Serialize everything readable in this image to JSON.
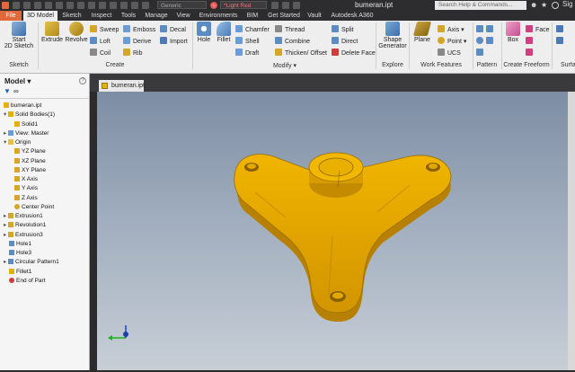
{
  "app": {
    "window_title": "bumeran.ipt",
    "material": "Generic",
    "appearance": "Light Red",
    "search_placeholder": "Search Help & Commands..."
  },
  "tabs": [
    "File",
    "3D Model",
    "Sketch",
    "Inspect",
    "Tools",
    "Manage",
    "View",
    "Environments",
    "BIM",
    "Get Started",
    "Vault",
    "Autodesk A360"
  ],
  "active_tab": "3D Model",
  "ribbon": {
    "sketch": {
      "panel": "Sketch",
      "start_line1": "Start",
      "start_line2": "2D Sketch"
    },
    "create": {
      "panel": "Create",
      "extrude": "Extrude",
      "revolve": "Revolve",
      "sweep": "Sweep",
      "loft": "Loft",
      "coil": "Coil",
      "emboss": "Emboss",
      "derive": "Derive",
      "rib": "Rib",
      "decal": "Decal",
      "import": "Import"
    },
    "modify": {
      "panel": "Modify",
      "hole": "Hole",
      "fillet": "Fillet",
      "chamfer": "Chamfer",
      "shell": "Shell",
      "draft": "Draft",
      "thread": "Thread",
      "combine": "Combine",
      "thicken": "Thicken/ Offset",
      "split": "Split",
      "direct": "Direct",
      "delete_face": "Delete Face"
    },
    "explore": {
      "panel": "Explore",
      "shape_line1": "Shape",
      "shape_line2": "Generator"
    },
    "work": {
      "panel": "Work Features",
      "plane": "Plane",
      "axis": "Axis",
      "point": "Point",
      "ucs": "UCS"
    },
    "pattern": {
      "panel": "Pattern"
    },
    "freeform": {
      "panel": "Create Freeform",
      "box": "Box",
      "face": "Face"
    },
    "surface": {
      "panel": "Surfa"
    }
  },
  "browser": {
    "title": "Model",
    "items": [
      {
        "label": "bumeran.ipt",
        "indent": 0,
        "icon": "part-icon"
      },
      {
        "label": "Solid Bodies(1)",
        "indent": 1,
        "icon": "solid-bodies-icon"
      },
      {
        "label": "Solid1",
        "indent": 2,
        "icon": "solid-icon"
      },
      {
        "label": "View: Master",
        "indent": 1,
        "icon": "view-icon"
      },
      {
        "label": "Origin",
        "indent": 1,
        "icon": "folder-icon"
      },
      {
        "label": "YZ Plane",
        "indent": 2,
        "icon": "plane-icon"
      },
      {
        "label": "XZ Plane",
        "indent": 2,
        "icon": "plane-icon"
      },
      {
        "label": "XY Plane",
        "indent": 2,
        "icon": "plane-icon"
      },
      {
        "label": "X Axis",
        "indent": 2,
        "icon": "axis-icon"
      },
      {
        "label": "Y Axis",
        "indent": 2,
        "icon": "axis-icon"
      },
      {
        "label": "Z Axis",
        "indent": 2,
        "icon": "axis-icon"
      },
      {
        "label": "Center Point",
        "indent": 2,
        "icon": "point-icon"
      },
      {
        "label": "Extrusion1",
        "indent": 1,
        "icon": "extrusion-icon"
      },
      {
        "label": "Revolution1",
        "indent": 1,
        "icon": "revolution-icon"
      },
      {
        "label": "Extrusion3",
        "indent": 1,
        "icon": "extrusion-icon"
      },
      {
        "label": "Hole1",
        "indent": 1,
        "icon": "hole-icon"
      },
      {
        "label": "Hole3",
        "indent": 1,
        "icon": "hole-icon"
      },
      {
        "label": "Circular Pattern1",
        "indent": 1,
        "icon": "pattern-icon"
      },
      {
        "label": "Fillet1",
        "indent": 1,
        "icon": "fillet-icon"
      },
      {
        "label": "End of Part",
        "indent": 1,
        "icon": "end-of-part-icon"
      }
    ]
  },
  "document_tab": "bumeran.ipt",
  "colors": {
    "accent": "#e1683a",
    "part": "#e8a800",
    "part_dark": "#b07a00",
    "ribbon": "#eeeeee"
  }
}
